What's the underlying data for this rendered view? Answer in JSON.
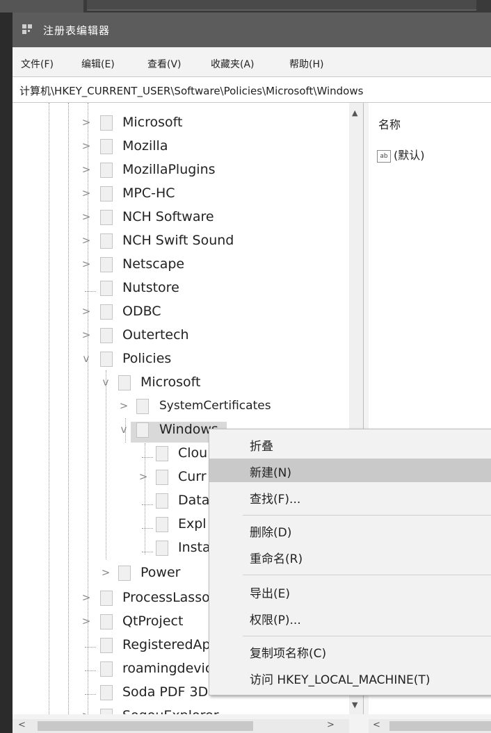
{
  "window": {
    "title": "注册表编辑器"
  },
  "menu": [
    "文件(F)",
    "编辑(E)",
    "查看(V)",
    "收藏夹(A)",
    "帮助(H)"
  ],
  "address": "计算机\\HKEY_CURRENT_USER\\Software\\Policies\\Microsoft\\Windows",
  "tree": [
    {
      "label": "Microsoft",
      "chev": ">"
    },
    {
      "label": "Mozilla",
      "chev": ">"
    },
    {
      "label": "MozillaPlugins",
      "chev": ">"
    },
    {
      "label": "MPC-HC",
      "chev": ">"
    },
    {
      "label": "NCH Software",
      "chev": ">"
    },
    {
      "label": "NCH Swift Sound",
      "chev": ">"
    },
    {
      "label": "Netscape",
      "chev": ">"
    },
    {
      "label": "Nutstore",
      "chev": ""
    },
    {
      "label": "ODBC",
      "chev": ">"
    },
    {
      "label": "Outertech",
      "chev": ">"
    },
    {
      "label": "Policies",
      "chev": "v"
    },
    {
      "label": "Microsoft",
      "chev": "v"
    },
    {
      "label": "SystemCertificates",
      "chev": ">"
    },
    {
      "label": "Windows",
      "chev": "v"
    },
    {
      "label": "Clou",
      "chev": ""
    },
    {
      "label": "Curr",
      "chev": ">"
    },
    {
      "label": "Data",
      "chev": ""
    },
    {
      "label": "Expl",
      "chev": ""
    },
    {
      "label": "Insta",
      "chev": ""
    },
    {
      "label": "Power",
      "chev": ">"
    },
    {
      "label": "ProcessLasso",
      "chev": ">"
    },
    {
      "label": "QtProject",
      "chev": ">"
    },
    {
      "label": "RegisteredApplications",
      "chev": ""
    },
    {
      "label": "roamingdevice",
      "chev": ""
    },
    {
      "label": "Soda PDF 3D",
      "chev": ""
    },
    {
      "label": "SogouExplorer",
      "chev": ">"
    }
  ],
  "list": {
    "column": "名称",
    "default_icon": "ab",
    "default_value": "(默认)"
  },
  "context_menu": [
    {
      "label": "折叠"
    },
    {
      "label": "新建(N)"
    },
    {
      "label": "查找(F)..."
    },
    {
      "label": "删除(D)"
    },
    {
      "label": "重命名(R)"
    },
    {
      "label": "导出(E)"
    },
    {
      "label": "权限(P)..."
    },
    {
      "label": "复制项名称(C)"
    },
    {
      "label": "访问 HKEY_LOCAL_MACHINE(T)"
    }
  ],
  "icons": {
    "app": "registry-icon",
    "folder": "folder-icon",
    "chevron": "chevron-icon",
    "scroll_up": "▲",
    "scroll_down": "▼",
    "scroll_left": "<",
    "scroll_right": ">"
  }
}
